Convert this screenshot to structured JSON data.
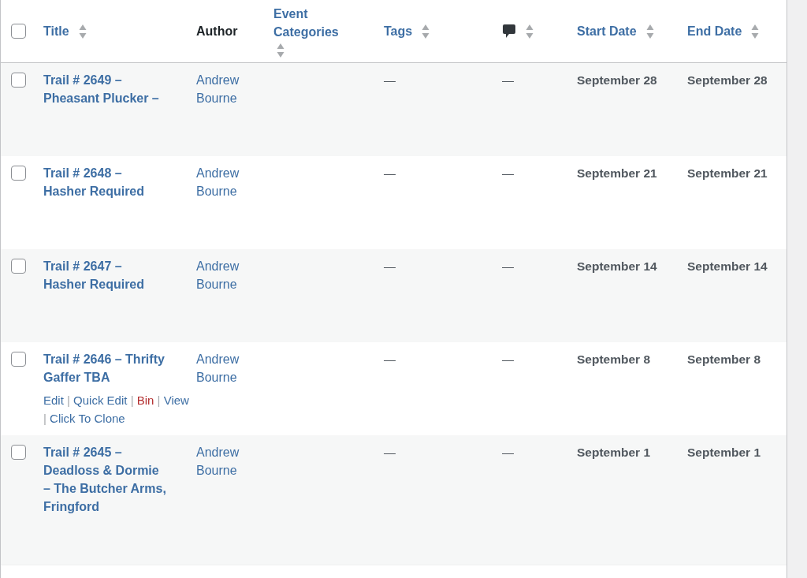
{
  "table": {
    "select_all": {
      "checked": false
    },
    "columns": [
      {
        "kind": "text",
        "label": "Title",
        "sortable": true
      },
      {
        "kind": "text",
        "label": "Author",
        "sortable": false
      },
      {
        "kind": "text",
        "label": "Event Categories",
        "sortable": true
      },
      {
        "kind": "text",
        "label": "Tags",
        "sortable": true
      },
      {
        "kind": "comments",
        "sortable": true
      },
      {
        "kind": "text",
        "label": "Start Date",
        "sortable": true
      },
      {
        "kind": "text",
        "label": "End Date",
        "sortable": true
      }
    ],
    "rows": [
      {
        "checked": false,
        "title": "Trail # 2649 – Pheasant Plucker –",
        "author": "Andrew Bourne",
        "tags": "—",
        "comments": "—",
        "start_date": "September 28",
        "end_date": "September 28"
      },
      {
        "checked": false,
        "title": "Trail # 2648 – Hasher Required",
        "author": "Andrew Bourne",
        "tags": "—",
        "comments": "—",
        "start_date": "September 21",
        "end_date": "September 21"
      },
      {
        "checked": false,
        "title": "Trail # 2647 – Hasher Required",
        "author": "Andrew Bourne",
        "tags": "—",
        "comments": "—",
        "start_date": "September 14",
        "end_date": "September 14"
      },
      {
        "checked": false,
        "title": "Trail # 2646 – Thrifty Gaffer TBA",
        "author": "Andrew Bourne",
        "tags": "—",
        "comments": "—",
        "start_date": "September 8",
        "end_date": "September 8",
        "separator": "|",
        "actions": [
          {
            "kind": "link",
            "label": "Edit"
          },
          {
            "kind": "link",
            "label": "Quick Edit"
          },
          {
            "kind": "delete",
            "label": "Bin"
          },
          {
            "kind": "link",
            "label": "View"
          },
          {
            "kind": "link",
            "label": "Click To Clone"
          }
        ]
      },
      {
        "checked": false,
        "title": "Trail # 2645 – Deadloss & Dormie – The Butcher Arms, Fringford",
        "author": "Andrew Bourne",
        "tags": "—",
        "comments": "—",
        "start_date": "September 1",
        "end_date": "September 1"
      }
    ]
  }
}
